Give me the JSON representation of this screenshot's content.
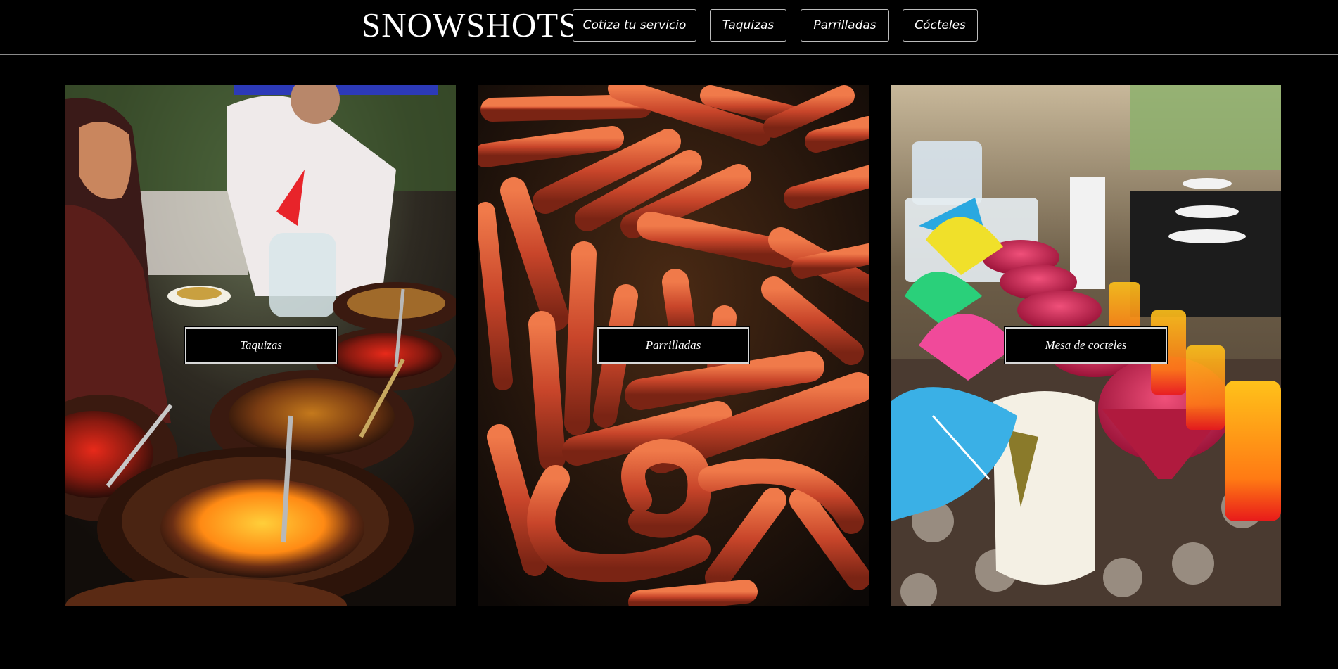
{
  "header": {
    "brand": "SNOWSHOTS",
    "nav": [
      {
        "label": "Cotiza tu servicio"
      },
      {
        "label": "Taquizas"
      },
      {
        "label": "Parrilladas"
      },
      {
        "label": "Cócteles"
      }
    ]
  },
  "cards": [
    {
      "label": "Taquizas",
      "image": "taquiza-buffet-photo"
    },
    {
      "label": "Parrilladas",
      "image": "grilled-sausages-photo"
    },
    {
      "label": "Mesa de cocteles",
      "image": "cocktail-table-photo"
    }
  ],
  "colors": {
    "background": "#000000",
    "text": "#ffffff",
    "border": "#bcbcbc"
  }
}
